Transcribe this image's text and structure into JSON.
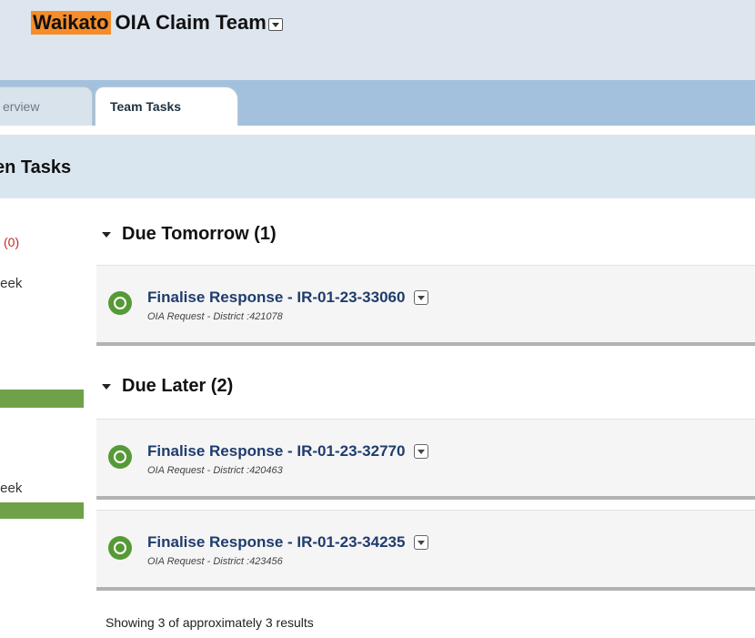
{
  "header": {
    "team_highlight": "Waikato",
    "team_rest": "OIA Claim Team"
  },
  "tabs": [
    {
      "label": "erview"
    },
    {
      "label": "Team Tasks"
    }
  ],
  "section": {
    "title": "en Tasks"
  },
  "sidebar": {
    "count": "(0)",
    "week_label_1": "/eek",
    "week_label_2": "/eek"
  },
  "groups": [
    {
      "title": "Due Tomorrow (1)",
      "tasks": [
        {
          "title": "Finalise Response - IR-01-23-33060",
          "subtitle": "OIA Request - District :421078"
        }
      ]
    },
    {
      "title": "Due Later (2)",
      "tasks": [
        {
          "title": "Finalise Response - IR-01-23-32770",
          "subtitle": "OIA Request - District :420463"
        },
        {
          "title": "Finalise Response - IR-01-23-34235",
          "subtitle": "OIA Request - District :423456"
        }
      ]
    }
  ],
  "footer": {
    "results_text": "Showing 3 of approximately 3 results"
  },
  "colors": {
    "accent": "#f58d2a",
    "task_link": "#1f3c6e",
    "task_icon": "#569a37",
    "progress": "#6fa248"
  }
}
